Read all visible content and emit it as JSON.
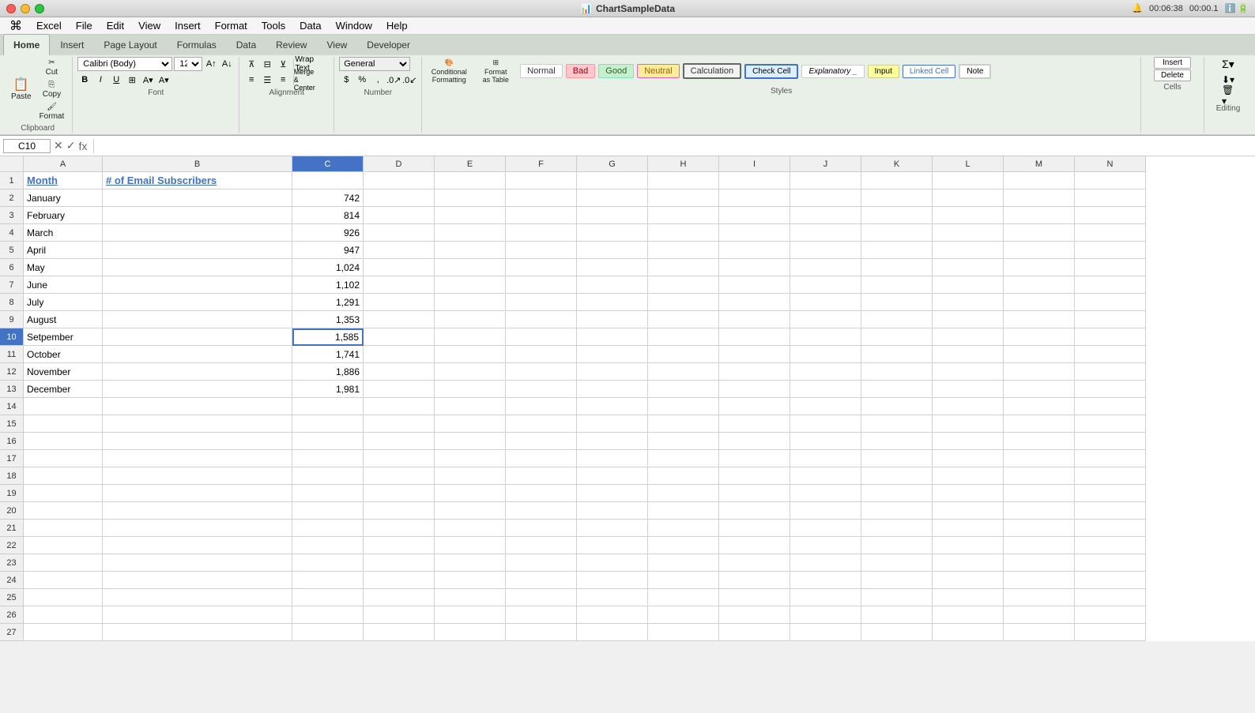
{
  "app": {
    "name": "Excel",
    "file_title": "ChartSampleData",
    "time": "00:06:38",
    "time2": "00:00.1"
  },
  "macos_menu": {
    "apple": "⌘",
    "items": [
      "Excel",
      "File",
      "Edit",
      "View",
      "Insert",
      "Format",
      "Tools",
      "Data",
      "Window",
      "Help"
    ]
  },
  "ribbon": {
    "tabs": [
      "Home",
      "Insert",
      "Page Layout",
      "Formulas",
      "Data",
      "Review",
      "View",
      "Developer"
    ],
    "active_tab": "Home"
  },
  "toolbar": {
    "font_name": "Calibri (Body)",
    "font_size": "12",
    "paste_label": "Paste",
    "cut_label": "Cut",
    "copy_label": "Copy",
    "format_label": "Format",
    "wrap_text": "Wrap Text",
    "number_format": "General",
    "merge_center": "Merge & Center",
    "format_group_label": "Clipboard",
    "font_group_label": "Font",
    "alignment_group_label": "Alignment",
    "number_group_label": "Number",
    "styles_group_label": "Styles",
    "cells_group_label": "Cells",
    "styles": {
      "normal": "Normal",
      "bad": "Bad",
      "good": "Good",
      "neutral": "Neutral",
      "calculation": "Calculation",
      "check_cell": "Check Cell",
      "explanatory": "Explanatory _",
      "input": "Input",
      "linked_cell": "Linked Cell",
      "note": "Note"
    },
    "conditional_formatting": "Conditional\nFormatting",
    "format_as_table": "Format\nas Table",
    "insert_btn": "Insert",
    "delete_btn": "Delete"
  },
  "formula_bar": {
    "cell_ref": "C10",
    "formula": "fx"
  },
  "columns": [
    "",
    "A",
    "B",
    "C",
    "D",
    "E",
    "F",
    "G",
    "H",
    "I",
    "J",
    "K",
    "L",
    "M",
    "N"
  ],
  "spreadsheet": {
    "selected_cell": "C10",
    "rows": [
      {
        "num": 1,
        "a": "Month",
        "b": "# of Email Subscribers",
        "c": "",
        "is_header": true
      },
      {
        "num": 2,
        "a": "January",
        "b": "",
        "c": "742"
      },
      {
        "num": 3,
        "a": "February",
        "b": "",
        "c": "814"
      },
      {
        "num": 4,
        "a": "March",
        "b": "",
        "c": "926"
      },
      {
        "num": 5,
        "a": "April",
        "b": "",
        "c": "947"
      },
      {
        "num": 6,
        "a": "May",
        "b": "",
        "c": "1,024"
      },
      {
        "num": 7,
        "a": "June",
        "b": "",
        "c": "1,102"
      },
      {
        "num": 8,
        "a": "July",
        "b": "",
        "c": "1,291"
      },
      {
        "num": 9,
        "a": "August",
        "b": "",
        "c": "1,353"
      },
      {
        "num": 10,
        "a": "Setpember",
        "b": "",
        "c": "1,585"
      },
      {
        "num": 11,
        "a": "October",
        "b": "",
        "c": "1,741"
      },
      {
        "num": 12,
        "a": "November",
        "b": "",
        "c": "1,886"
      },
      {
        "num": 13,
        "a": "December",
        "b": "",
        "c": "1,981"
      },
      {
        "num": 14,
        "a": "",
        "b": "",
        "c": ""
      },
      {
        "num": 15,
        "a": "",
        "b": "",
        "c": ""
      },
      {
        "num": 16,
        "a": "",
        "b": "",
        "c": ""
      },
      {
        "num": 17,
        "a": "",
        "b": "",
        "c": ""
      },
      {
        "num": 18,
        "a": "",
        "b": "",
        "c": ""
      },
      {
        "num": 19,
        "a": "",
        "b": "",
        "c": ""
      },
      {
        "num": 20,
        "a": "",
        "b": "",
        "c": ""
      },
      {
        "num": 21,
        "a": "",
        "b": "",
        "c": ""
      },
      {
        "num": 22,
        "a": "",
        "b": "",
        "c": ""
      },
      {
        "num": 23,
        "a": "",
        "b": "",
        "c": ""
      },
      {
        "num": 24,
        "a": "",
        "b": "",
        "c": ""
      },
      {
        "num": 25,
        "a": "",
        "b": "",
        "c": ""
      },
      {
        "num": 26,
        "a": "",
        "b": "",
        "c": ""
      },
      {
        "num": 27,
        "a": "",
        "b": "",
        "c": ""
      }
    ]
  }
}
